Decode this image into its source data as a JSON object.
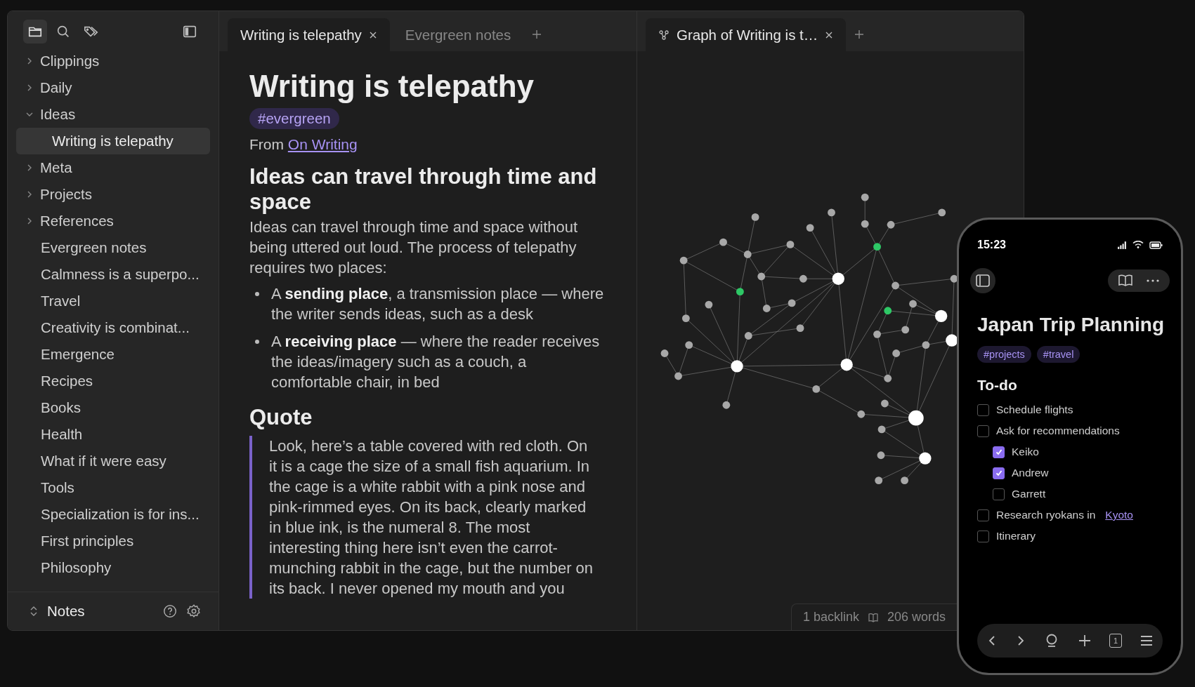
{
  "sidebar": {
    "items": [
      {
        "label": "Clippings",
        "kind": "folder",
        "expanded": false,
        "selected": false
      },
      {
        "label": "Daily",
        "kind": "folder",
        "expanded": false,
        "selected": false
      },
      {
        "label": "Ideas",
        "kind": "folder",
        "expanded": true,
        "selected": false,
        "children": [
          {
            "label": "Writing is telepathy",
            "kind": "file",
            "selected": true
          }
        ]
      },
      {
        "label": "Meta",
        "kind": "folder",
        "expanded": false,
        "selected": false
      },
      {
        "label": "Projects",
        "kind": "folder",
        "expanded": false,
        "selected": false
      },
      {
        "label": "References",
        "kind": "folder",
        "expanded": false,
        "selected": false
      },
      {
        "label": "Evergreen notes",
        "kind": "file",
        "selected": false
      },
      {
        "label": "Calmness is a superpo...",
        "kind": "file",
        "selected": false
      },
      {
        "label": "Travel",
        "kind": "file",
        "selected": false
      },
      {
        "label": "Creativity is combinat...",
        "kind": "file",
        "selected": false
      },
      {
        "label": "Emergence",
        "kind": "file",
        "selected": false
      },
      {
        "label": "Recipes",
        "kind": "file",
        "selected": false
      },
      {
        "label": "Books",
        "kind": "file",
        "selected": false
      },
      {
        "label": "Health",
        "kind": "file",
        "selected": false
      },
      {
        "label": "What if it were easy",
        "kind": "file",
        "selected": false
      },
      {
        "label": "Tools",
        "kind": "file",
        "selected": false
      },
      {
        "label": "Specialization is for ins...",
        "kind": "file",
        "selected": false
      },
      {
        "label": "First principles",
        "kind": "file",
        "selected": false
      },
      {
        "label": "Philosophy",
        "kind": "file",
        "selected": false
      }
    ],
    "vault": "Notes"
  },
  "editor": {
    "tabs": [
      {
        "label": "Writing is telepathy",
        "selected": true
      },
      {
        "label": "Evergreen notes",
        "selected": false
      }
    ]
  },
  "note": {
    "title": "Writing is telepathy",
    "tag": "#evergreen",
    "from_label": "From",
    "from_link": "On Writing",
    "heading": "Ideas can travel through time and space",
    "paragraph": "Ideas can travel through time and space without being uttered out loud. The process of telepathy requires two places:",
    "bullets": [
      "A **sending place**, a transmission place — where the writer sends ideas, such as a desk",
      "A **receiving place** — where the reader receives the ideas/imagery such as a couch, a comfortable chair, in bed"
    ],
    "quote_heading": "Quote",
    "quote": "Look, here’s a table covered with red cloth. On it is a cage the size of a small fish aquarium. In the cage is a white rabbit with a pink nose and pink-rimmed eyes. On its back, clearly marked in blue ink, is the numeral 8. The most interesting thing here isn’t even the carrot-munching rabbit in the cage, but the number on its back. I never opened my mouth and you"
  },
  "graph": {
    "tabs": [
      {
        "label": "Graph of Writing is t…",
        "selected": true
      }
    ],
    "backlinks": "1 backlink",
    "words": "206 words"
  },
  "phone": {
    "time": "15:23",
    "title": "Japan Trip Planning",
    "tags": [
      "#projects",
      "#travel"
    ],
    "heading": "To-do",
    "tasks": [
      {
        "label": "Schedule flights",
        "checked": false
      },
      {
        "label": "Ask for recommendations",
        "checked": false,
        "children": [
          {
            "label": "Keiko",
            "checked": true
          },
          {
            "label": "Andrew",
            "checked": true
          },
          {
            "label": "Garrett",
            "checked": false
          }
        ]
      },
      {
        "label": "Research ryokans in",
        "link": "Kyoto",
        "checked": false
      },
      {
        "label": "Itinerary",
        "checked": false
      }
    ],
    "tab_count": "1"
  }
}
